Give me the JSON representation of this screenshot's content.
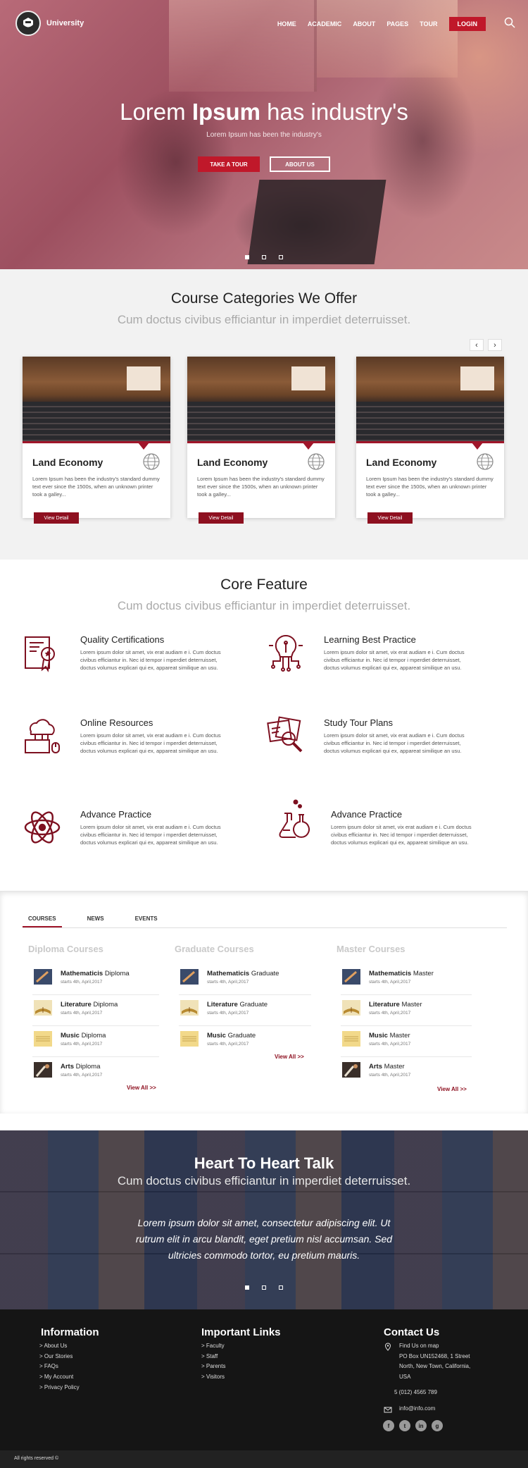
{
  "header": {
    "logo_text": "University",
    "nav": [
      "HOME",
      "ACADEMIC",
      "ABOUT",
      "PAGES",
      "TOUR"
    ],
    "login_label": "LOGIN",
    "accent": "#c0182a"
  },
  "hero": {
    "title_pre": "Lorem ",
    "title_bold": "Ipsum",
    "title_post": " has industry's",
    "subtitle": "Lorem Ipsum has been the industry's",
    "btn_tour": "TAKE A TOUR",
    "btn_about": "ABOUT US"
  },
  "categories": {
    "title": "Course Categories We Offer",
    "subtitle": "Cum doctus civibus efficiantur in imperdiet deterruisset.",
    "prev_icon": "chevron-left-icon",
    "next_icon": "chevron-right-icon",
    "cards": [
      {
        "title": "Land Economy",
        "desc": "Lorem Ipsum has been the industry's standard dummy text ever since the 1500s, when an unknown printer took a galley...",
        "button": "View Detail"
      },
      {
        "title": "Land Economy",
        "desc": "Lorem Ipsum has been the industry's standard dummy text ever since the 1500s, when an unknown printer took a galley...",
        "button": "View Detail"
      },
      {
        "title": "Land Economy",
        "desc": "Lorem Ipsum has been the industry's standard dummy text ever since the 1500s, when an unknown printer took a galley...",
        "button": "View Detail"
      }
    ]
  },
  "core": {
    "title": "Core Feature",
    "subtitle": "Cum doctus civibus efficiantur in imperdiet deterruisset.",
    "features": [
      {
        "title": "Quality Certifications",
        "desc": "Lorem ipsum dolor sit amet, vix erat audiam e i. Cum doctus civibus efficiantur in. Nec id tempor i mperdiet deterruisset, doctus volumus explicari qui ex, appareat similique an usu.",
        "icon": "certificate-icon"
      },
      {
        "title": "Learning Best Practice",
        "desc": "Lorem ipsum dolor sit amet, vix erat audiam e i. Cum doctus civibus efficiantur in. Nec id tempor i mperdiet deterruisset, doctus volumus explicari qui ex, appareat similique an usu.",
        "icon": "lightbulb-circuit-icon"
      },
      {
        "title": "Online Resources",
        "desc": "Lorem ipsum dolor sit amet, vix erat audiam e i. Cum doctus civibus efficiantur in. Nec id tempor i mperdiet deterruisset, doctus volumus explicari qui ex, appareat similique an usu.",
        "icon": "cloud-computer-icon"
      },
      {
        "title": "Study Tour Plans",
        "desc": "Lorem ipsum dolor sit amet, vix erat audiam e i. Cum doctus civibus efficiantur in. Nec id tempor i mperdiet deterruisset, doctus volumus explicari qui ex, appareat similique an usu.",
        "icon": "magnifier-documents-icon"
      },
      {
        "title": "Advance Practice",
        "desc": "Lorem ipsum dolor sit amet, vix erat audiam e i. Cum doctus civibus efficiantur in. Nec id tempor i mperdiet deterruisset, doctus volumus explicari qui ex, appareat similique an usu.",
        "icon": "atom-icon"
      },
      {
        "title": "Advance Practice",
        "desc": "Lorem ipsum dolor sit amet, vix erat audiam e i. Cum doctus civibus efficiantur in. Nec id tempor i mperdiet deterruisset, doctus volumus explicari qui ex, appareat similique an usu.",
        "icon": "flask-icon"
      }
    ]
  },
  "tabs": {
    "labels": [
      "COURSES",
      "NEWS",
      "EVENTS"
    ],
    "active": "COURSES",
    "view_all": "View All >>",
    "columns": [
      {
        "heading": "Diploma Courses",
        "items": [
          {
            "bold": "Mathematicis",
            "rest": " Diploma",
            "date": "starts 4th, April,2017"
          },
          {
            "bold": "Literature",
            "rest": " Diploma",
            "date": "starts 4th, April,2017"
          },
          {
            "bold": "Music",
            "rest": " Diploma",
            "date": "starts 4th, April,2017"
          },
          {
            "bold": "Arts",
            "rest": " Diploma",
            "date": "starts 4th, April,2017"
          }
        ]
      },
      {
        "heading": "Graduate Courses",
        "items": [
          {
            "bold": "Mathematicis",
            "rest": " Graduate",
            "date": "starts 4th, April,2017"
          },
          {
            "bold": "Literature",
            "rest": " Graduate",
            "date": "starts 4th, April,2017"
          },
          {
            "bold": "Music",
            "rest": " Graduate",
            "date": "starts 4th, April,2017"
          }
        ]
      },
      {
        "heading": "Master Courses",
        "items": [
          {
            "bold": "Mathematicis",
            "rest": " Master",
            "date": "starts 4th, April,2017"
          },
          {
            "bold": "Literature",
            "rest": " Master",
            "date": "starts 4th, April,2017"
          },
          {
            "bold": "Music",
            "rest": " Master",
            "date": "starts 4th, April,2017"
          },
          {
            "bold": "Arts",
            "rest": " Master",
            "date": "starts 4th, April,2017"
          }
        ]
      }
    ]
  },
  "testimonial": {
    "title": "Heart To Heart Talk",
    "subtitle": "Cum doctus civibus efficiantur in imperdiet deterruisset.",
    "quote": "Lorem ipsum dolor sit amet, consectetur adipiscing elit. Ut rutrum elit in arcu blandit, eget pretium nisl accumsan. Sed ultricies commodo tortor, eu pretium mauris."
  },
  "footer": {
    "info_title": "Information",
    "info_links": [
      "> About Us",
      "> Our Stories",
      "> FAQs",
      "> My Account",
      "> Privacy Policy"
    ],
    "links_title": "Important Links",
    "links": [
      "> Faculty",
      "> Staff",
      "> Parents",
      "> Visitors"
    ],
    "contact_title": "Contact Us",
    "map_label": "Find Us on map",
    "address": [
      "PO Box UN152468, 1 Street",
      "North, New Town, California,",
      "USA"
    ],
    "phone": "5 (012) 4565 789",
    "email": "info@info.com",
    "socials": [
      "f",
      "t",
      "in",
      "g"
    ],
    "copyright": "All rights reserved ©"
  }
}
